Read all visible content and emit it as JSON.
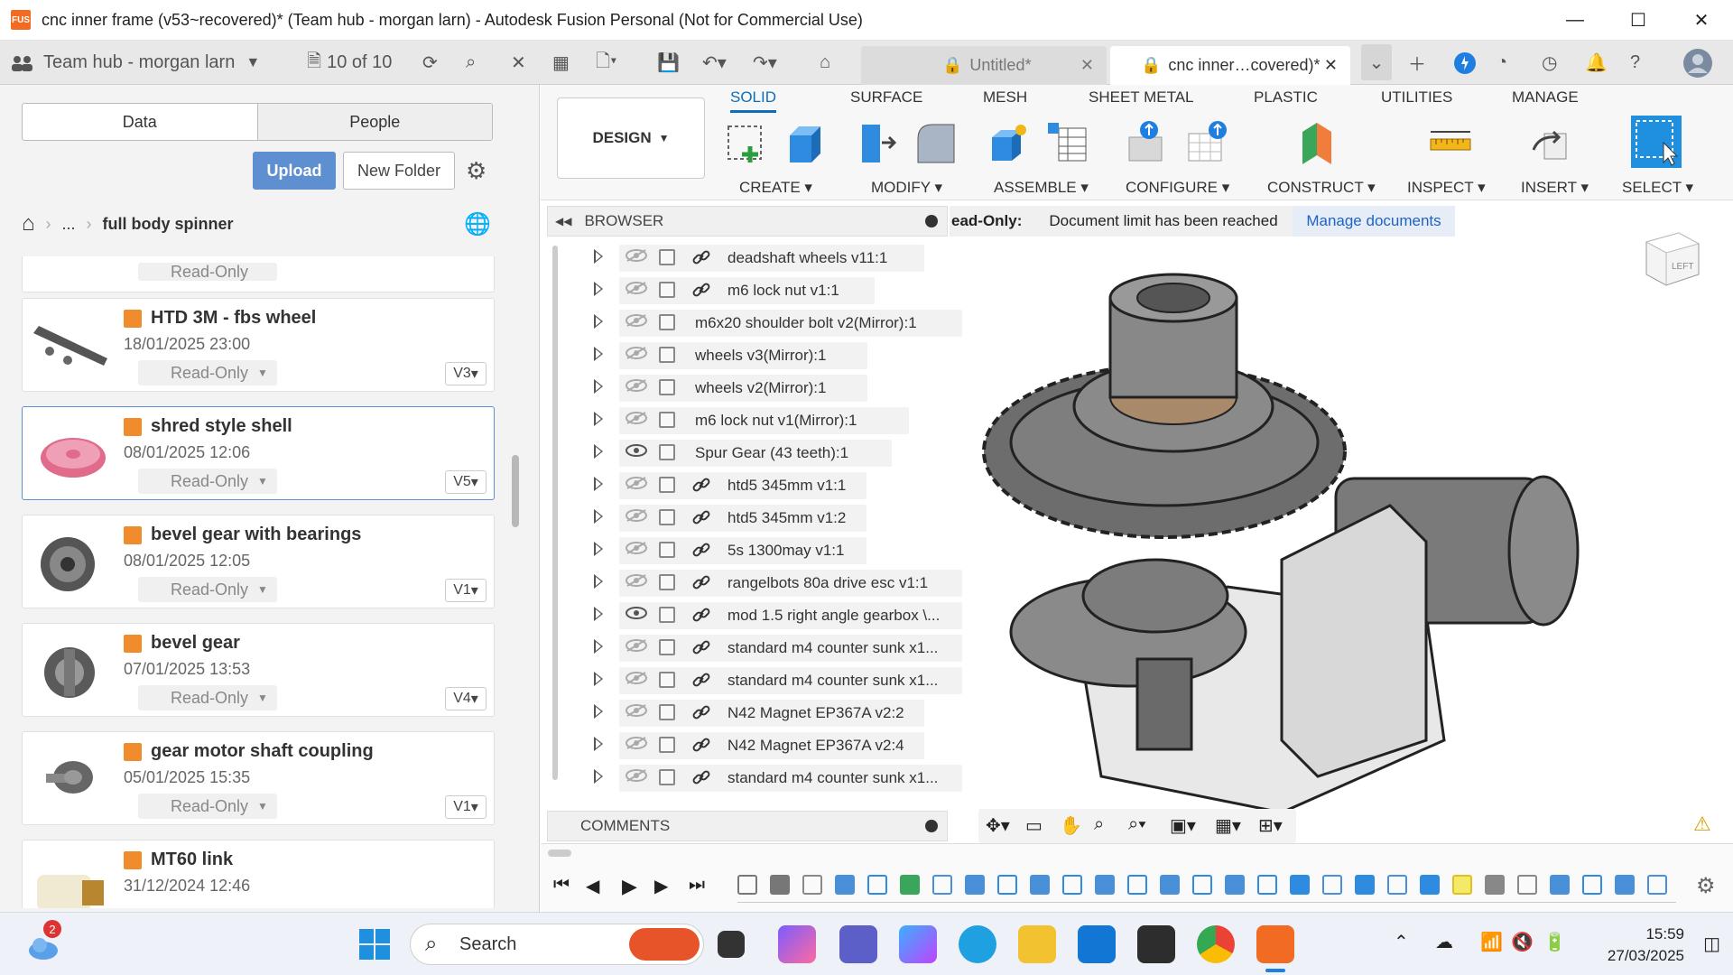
{
  "window": {
    "title": "cnc inner frame (v53~recovered)* (Team hub - morgan larn) - Autodesk Fusion Personal (Not for Commercial Use)",
    "logo_text": "FUS"
  },
  "tabbar": {
    "hub": "Team hub - morgan larn",
    "doc_count": "10 of 10",
    "tabs": [
      {
        "label": "Untitled*"
      },
      {
        "label": "cnc inner…covered)*"
      }
    ]
  },
  "data_panel": {
    "segments": [
      "Data",
      "People"
    ],
    "upload": "Upload",
    "new_folder": "New Folder",
    "breadcrumb": {
      "ellipsis": "...",
      "current": "full body spinner"
    },
    "partial_top_readonly": "Read-Only",
    "cards": [
      {
        "name": "HTD 3M - fbs wheel",
        "date": "18/01/2025 23:00",
        "status": "Read-Only",
        "version": "V3"
      },
      {
        "name": "shred style shell",
        "date": "08/01/2025 12:06",
        "status": "Read-Only",
        "version": "V5"
      },
      {
        "name": "bevel gear with bearings",
        "date": "08/01/2025 12:05",
        "status": "Read-Only",
        "version": "V1"
      },
      {
        "name": "bevel gear",
        "date": "07/01/2025 13:53",
        "status": "Read-Only",
        "version": "V4"
      },
      {
        "name": "gear motor shaft coupling",
        "date": "05/01/2025 15:35",
        "status": "Read-Only",
        "version": "V1"
      },
      {
        "name": "MT60 link",
        "date": "31/12/2024 12:46",
        "status": "",
        "version": ""
      }
    ]
  },
  "ribbon": {
    "workspace": "DESIGN",
    "tabs": [
      "SOLID",
      "SURFACE",
      "MESH",
      "SHEET METAL",
      "PLASTIC",
      "UTILITIES",
      "MANAGE"
    ],
    "groups": [
      "CREATE",
      "MODIFY",
      "ASSEMBLE",
      "CONFIGURE",
      "CONSTRUCT",
      "INSPECT",
      "INSERT",
      "SELECT"
    ]
  },
  "browser": {
    "title": "BROWSER",
    "items": [
      {
        "label": "deadshaft wheels v11:1",
        "visible": false,
        "linked": true
      },
      {
        "label": "m6 lock nut v1:1",
        "visible": false,
        "linked": true
      },
      {
        "label": "m6x20 shoulder bolt v2(Mirror):1",
        "visible": false,
        "linked": false
      },
      {
        "label": "wheels v3(Mirror):1",
        "visible": false,
        "linked": false
      },
      {
        "label": "wheels v2(Mirror):1",
        "visible": false,
        "linked": false
      },
      {
        "label": "m6 lock nut v1(Mirror):1",
        "visible": false,
        "linked": false
      },
      {
        "label": "Spur Gear (43 teeth):1",
        "visible": true,
        "linked": false
      },
      {
        "label": "htd5 345mm v1:1",
        "visible": false,
        "linked": true
      },
      {
        "label": "htd5 345mm v1:2",
        "visible": false,
        "linked": true
      },
      {
        "label": "5s 1300may v1:1",
        "visible": false,
        "linked": true
      },
      {
        "label": "rangelbots 80a drive esc v1:1",
        "visible": false,
        "linked": true
      },
      {
        "label": "mod 1.5 right angle gearbox \\...",
        "visible": true,
        "linked": true
      },
      {
        "label": "standard m4 counter sunk x1...",
        "visible": false,
        "linked": true
      },
      {
        "label": "standard m4 counter sunk x1...",
        "visible": false,
        "linked": true
      },
      {
        "label": "N42 Magnet EP367A v2:2",
        "visible": false,
        "linked": true
      },
      {
        "label": "N42 Magnet EP367A v2:4",
        "visible": false,
        "linked": true
      },
      {
        "label": "standard m4 counter sunk x1...",
        "visible": false,
        "linked": true
      }
    ]
  },
  "notice": {
    "prefix": "ead-Only:",
    "message": "Document limit has been reached",
    "action": "Manage documents"
  },
  "viewcube_label": "LEFT",
  "comments": {
    "title": "COMMENTS"
  },
  "taskbar": {
    "search": "Search",
    "weather_badge": "2",
    "time": "15:59",
    "date": "27/03/2025"
  },
  "colors": {
    "accent": "#0a6ebd",
    "upload": "#5d8fd1",
    "fusion_orange": "#f26b22"
  }
}
